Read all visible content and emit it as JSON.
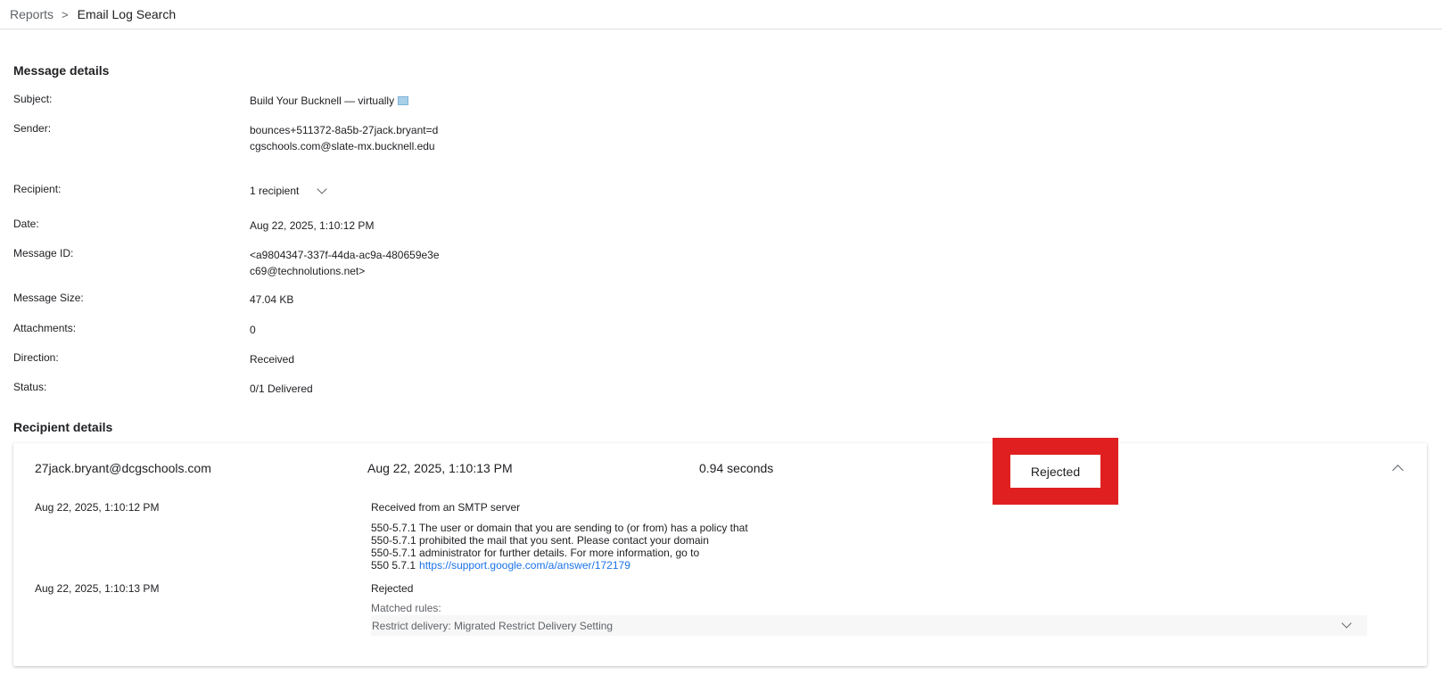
{
  "breadcrumb": {
    "root": "Reports",
    "separator": ">",
    "current": "Email Log Search"
  },
  "message_details": {
    "title": "Message details",
    "subject_label": "Subject:",
    "subject_value": "Build Your Bucknell — virtually",
    "sender_label": "Sender:",
    "sender_value": "bounces+511372-8a5b-27jack.bryant=dcgschools.com@slate-mx.bucknell.edu",
    "recipient_label": "Recipient:",
    "recipient_value": "1 recipient",
    "date_label": "Date:",
    "date_value": "Aug 22, 2025, 1:10:12 PM",
    "message_id_label": "Message ID:",
    "message_id_value": "<a9804347-337f-44da-ac9a-480659e3ec69@technolutions.net>",
    "size_label": "Message Size:",
    "size_value": "47.04 KB",
    "attachments_label": "Attachments:",
    "attachments_value": "0",
    "direction_label": "Direction:",
    "direction_value": "Received",
    "status_label": "Status:",
    "status_value": "0/1 Delivered"
  },
  "recipient_details": {
    "title": "Recipient details",
    "email": "27jack.bryant@dcgschools.com",
    "date": "Aug 22, 2025, 1:10:13 PM",
    "duration": "0.94 seconds",
    "status": "Rejected",
    "events": [
      {
        "time": "Aug 22, 2025, 1:10:12 PM",
        "title": "Received from an SMTP server",
        "lines": [
          "550-5.7.1 The user or domain that you are sending to (or from) has a policy that",
          "550-5.7.1 prohibited the mail that you sent. Please contact your domain",
          "550-5.7.1 administrator for further details. For more information, go to"
        ],
        "last_prefix": "550 5.7.1",
        "link": "https://support.google.com/a/answer/172179"
      },
      {
        "time": "Aug 22, 2025, 1:10:13 PM",
        "title": "Rejected",
        "matched_label": "Matched rules:",
        "rule": "Restrict delivery: Migrated Restrict Delivery Setting"
      }
    ]
  },
  "colors": {
    "highlight_box": "#e02020",
    "link": "#1a73e8"
  }
}
